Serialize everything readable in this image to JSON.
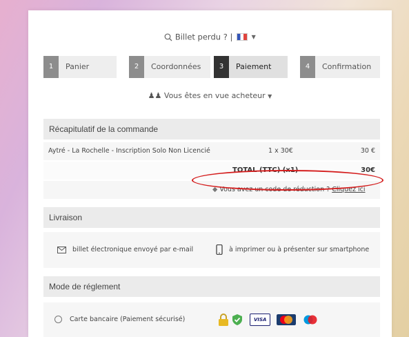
{
  "topbar": {
    "lost_ticket": "Billet perdu ?",
    "separator": "|",
    "language": "fr"
  },
  "steps": [
    {
      "num": "1",
      "label": "Panier"
    },
    {
      "num": "2",
      "label": "Coordonnées"
    },
    {
      "num": "3",
      "label": "Paiement"
    },
    {
      "num": "4",
      "label": "Confirmation"
    }
  ],
  "buyer": {
    "label": "Vous êtes en vue acheteur"
  },
  "summary": {
    "title": "Récapitulatif de la commande",
    "line": {
      "name": "Aytré - La Rochelle - Inscription Solo Non Licencié",
      "qty": "1 x 30€",
      "amount": "30 €"
    },
    "total_label": "TOTAL (TTC) (x1)",
    "total_amount": "30€",
    "discount_text": "Vous avez un code de réduction ?",
    "discount_link": "Cliquez ici"
  },
  "delivery": {
    "title": "Livraison",
    "email": "billet électronique envoyé par e-mail",
    "print": "à imprimer ou à présenter sur smartphone"
  },
  "payment": {
    "title": "Mode de réglement",
    "option": "Carte bancaire (Paiement sécurisé)",
    "brands": [
      "VISA",
      "Mastercard",
      "Maestro"
    ]
  },
  "colors": {
    "annotation": "#d41c1c",
    "active_step": "#333333",
    "step_num": "#8d8d8d"
  }
}
